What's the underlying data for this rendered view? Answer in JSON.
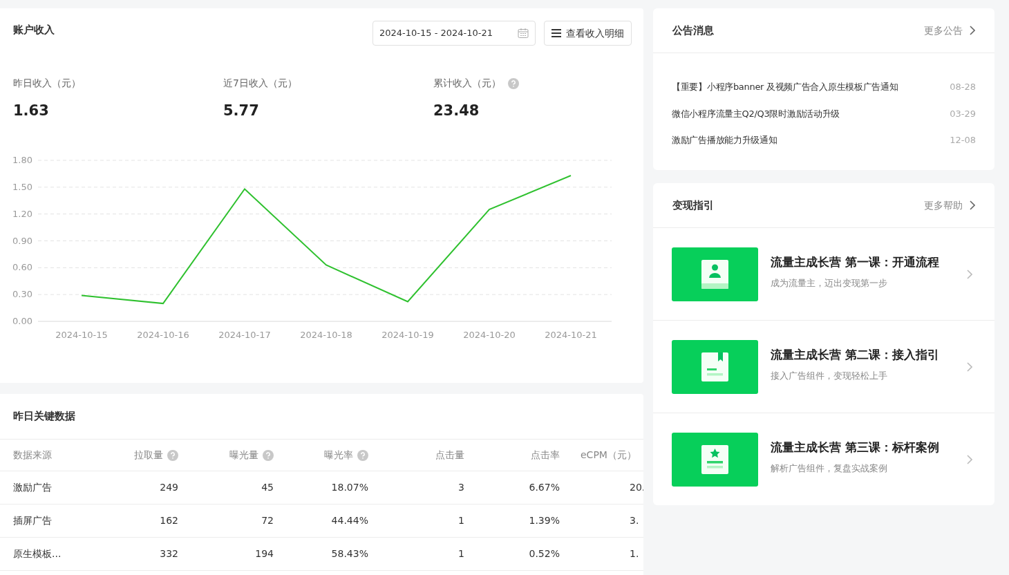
{
  "income": {
    "title": "账户收入",
    "date_range": "2024-10-15 - 2024-10-21",
    "detail_button": "查看收入明细",
    "stats": [
      {
        "label": "昨日收入（元）",
        "value": "1.63",
        "help": false
      },
      {
        "label": "近7日收入（元）",
        "value": "5.77",
        "help": false
      },
      {
        "label": "累计收入（元）",
        "value": "23.48",
        "help": true
      }
    ],
    "chart_data": {
      "type": "line",
      "categories": [
        "2024-10-15",
        "2024-10-16",
        "2024-10-17",
        "2024-10-18",
        "2024-10-19",
        "2024-10-20",
        "2024-10-21"
      ],
      "grid": true,
      "series": [
        {
          "color": "#2fc12f",
          "values": [
            0.29,
            0.2,
            1.48,
            0.63,
            0.22,
            1.25,
            1.63
          ]
        }
      ],
      "ylim": [
        0,
        1.8
      ],
      "yticks": [
        {
          "value": 0,
          "label": "0.00"
        },
        {
          "value": 0.3,
          "label": "0.30"
        },
        {
          "value": 0.6,
          "label": "0.60"
        },
        {
          "value": 0.9,
          "label": "0.90"
        },
        {
          "value": 1.2,
          "label": "1.20"
        },
        {
          "value": 1.5,
          "label": "1.50"
        },
        {
          "value": 1.8,
          "label": "1.80"
        }
      ]
    }
  },
  "key_data": {
    "title": "昨日关键数据",
    "columns": [
      {
        "label": "数据来源",
        "help": false
      },
      {
        "label": "拉取量",
        "help": true
      },
      {
        "label": "曝光量",
        "help": true
      },
      {
        "label": "曝光率",
        "help": true
      },
      {
        "label": "点击量",
        "help": false
      },
      {
        "label": "点击率",
        "help": false
      },
      {
        "label": "eCPM（元）",
        "help": false
      }
    ],
    "rows": [
      [
        "激励广告",
        "249",
        "45",
        "18.07%",
        "3",
        "6.67%",
        "20."
      ],
      [
        "插屏广告",
        "162",
        "72",
        "44.44%",
        "1",
        "1.39%",
        "3."
      ],
      [
        "原生模板...",
        "332",
        "194",
        "58.43%",
        "1",
        "0.52%",
        "1."
      ]
    ]
  },
  "announcements": {
    "title": "公告消息",
    "more": "更多公告",
    "items": [
      {
        "text": "【重要】小程序banner 及视频广告合入原生模板广告通知",
        "date": "08-28"
      },
      {
        "text": "微信小程序流量主Q2/Q3限时激励活动升级",
        "date": "03-29"
      },
      {
        "text": "激励广告播放能力升级通知",
        "date": "12-08"
      }
    ]
  },
  "guide": {
    "title": "变现指引",
    "more": "更多帮助",
    "courses": [
      {
        "kind": "person",
        "title": "流量主成长营 第一课：开通流程",
        "subtitle": "成为流量主，迈出变现第一步"
      },
      {
        "kind": "bookmark",
        "title": "流量主成长营 第二课：接入指引",
        "subtitle": "接入广告组件，变现轻松上手"
      },
      {
        "kind": "star",
        "title": "流量主成长营 第三课：标杆案例",
        "subtitle": "解析广告组件，复盘实战案例"
      }
    ]
  }
}
